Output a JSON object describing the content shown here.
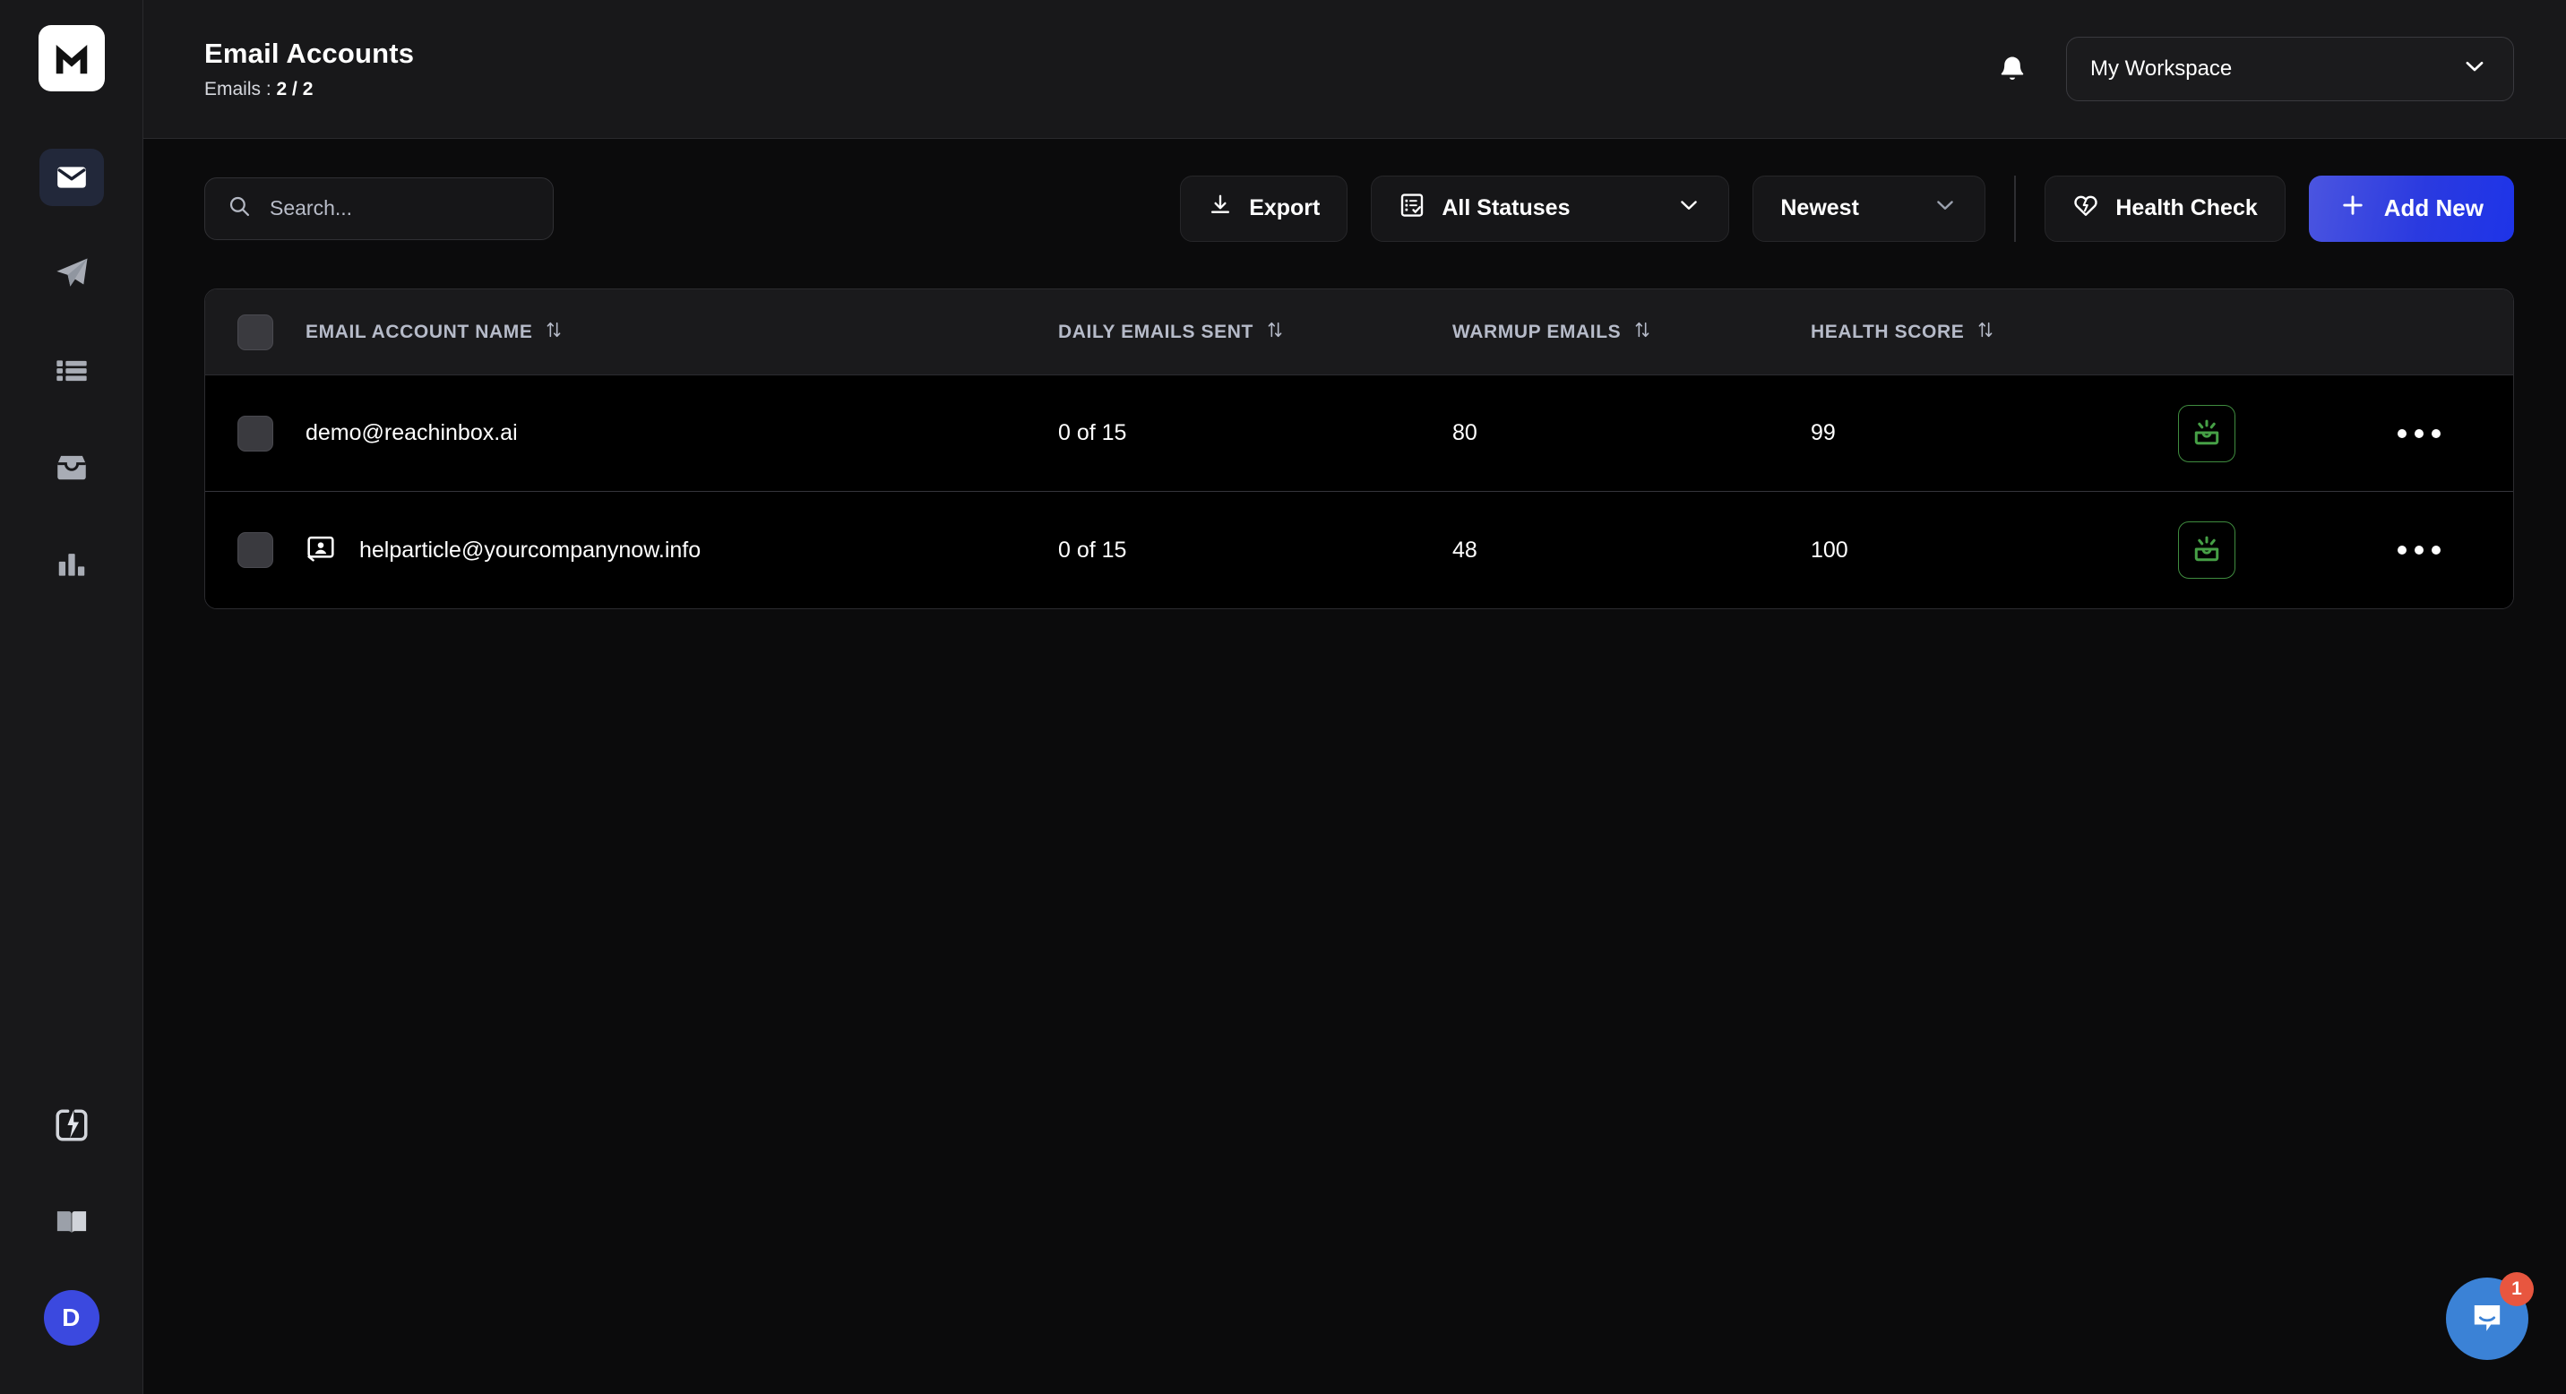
{
  "sidebar": {
    "logo_letter": "M",
    "nav_top": [
      {
        "icon": "mail-icon",
        "name": "sidebar-item-email-accounts",
        "active": true
      },
      {
        "icon": "paper-plane-icon",
        "name": "sidebar-item-campaigns",
        "active": false
      },
      {
        "icon": "list-icon",
        "name": "sidebar-item-lists",
        "active": false
      },
      {
        "icon": "inbox-icon",
        "name": "sidebar-item-inbox",
        "active": false
      },
      {
        "icon": "bar-chart-icon",
        "name": "sidebar-item-analytics",
        "active": false
      }
    ],
    "nav_bottom": [
      {
        "icon": "zap-square-icon",
        "name": "sidebar-item-integrations"
      },
      {
        "icon": "open-book-icon",
        "name": "sidebar-item-docs"
      }
    ],
    "avatar_letter": "D"
  },
  "header": {
    "title": "Email Accounts",
    "subtitle_label": "Emails : ",
    "subtitle_value": "2 / 2",
    "bell_icon": "bell-icon",
    "workspace": {
      "label": "My Workspace",
      "chevron_icon": "chevron-down-icon"
    }
  },
  "toolbar": {
    "search": {
      "placeholder": "Search...",
      "value": "",
      "icon": "search-icon"
    },
    "export": {
      "label": "Export",
      "icon": "download-icon"
    },
    "status_filter": {
      "label": "All Statuses",
      "icon": "checklist-icon",
      "chevron_icon": "chevron-down-icon"
    },
    "sort": {
      "label": "Newest",
      "chevron_icon": "chevron-down-icon"
    },
    "health_check": {
      "label": "Health Check",
      "icon": "heart-pulse-icon"
    },
    "add_new": {
      "label": "Add New",
      "icon": "plus-icon"
    }
  },
  "table": {
    "columns": [
      {
        "label": "EMAIL ACCOUNT NAME",
        "sort_icon": "sort-arrows-icon"
      },
      {
        "label": "DAILY EMAILS SENT",
        "sort_icon": "sort-arrows-icon"
      },
      {
        "label": "WARMUP EMAILS",
        "sort_icon": "sort-arrows-icon"
      },
      {
        "label": "HEALTH SCORE",
        "sort_icon": "sort-arrows-icon"
      }
    ],
    "rows": [
      {
        "checked": false,
        "avatar_icon": "",
        "email": "demo@reachinbox.ai",
        "daily_emails_sent": "0 of 15",
        "warmup_emails": "80",
        "health_score": "99",
        "warmup_status_icon": "warmup-active-icon",
        "more_icon": "more-horizontal-icon"
      },
      {
        "checked": false,
        "avatar_icon": "contact-card-icon",
        "email": "helparticle@yourcompanynow.info",
        "daily_emails_sent": "0 of 15",
        "warmup_emails": "48",
        "health_score": "100",
        "warmup_status_icon": "warmup-active-icon",
        "more_icon": "more-horizontal-icon"
      }
    ]
  },
  "chat_widget": {
    "icon": "chat-bubble-icon",
    "badge_count": "1"
  },
  "colors": {
    "accent_blue": "#3b49df",
    "warmup_green": "#3f8c3f",
    "badge_red": "#e8563f",
    "chat_blue": "#3b82d6",
    "sidebar_bg": "#18181a",
    "page_bg": "#0b0b0c"
  }
}
